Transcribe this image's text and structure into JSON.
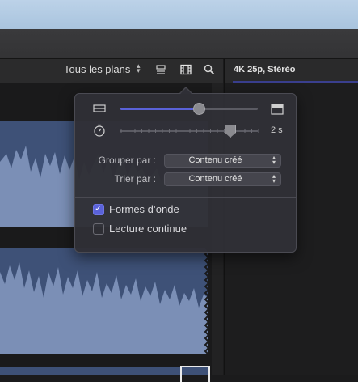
{
  "toolbar": {
    "clip_filter": "Tous les plans",
    "icons": [
      "updown-chevron-icon",
      "list-view-icon",
      "filmstrip-icon",
      "search-icon"
    ]
  },
  "viewer": {
    "format_label": "4K 25p, Stéréo"
  },
  "popover": {
    "clip_height_slider": {
      "value_fraction": 0.57
    },
    "duration_slider": {
      "value_fraction": 0.8,
      "value_label": "2 s"
    },
    "group_by": {
      "label": "Grouper par :",
      "value": "Contenu créé"
    },
    "sort_by": {
      "label": "Trier par :",
      "value": "Contenu créé"
    },
    "waveforms": {
      "label": "Formes d’onde",
      "checked": true
    },
    "continuous_playback": {
      "label": "Lecture continue",
      "checked": false
    }
  },
  "colors": {
    "accent": "#5a62d9",
    "clip_audio": "#3e5177",
    "clip_waveform": "#7b8fb6",
    "popover_bg": "#2f2f36"
  }
}
